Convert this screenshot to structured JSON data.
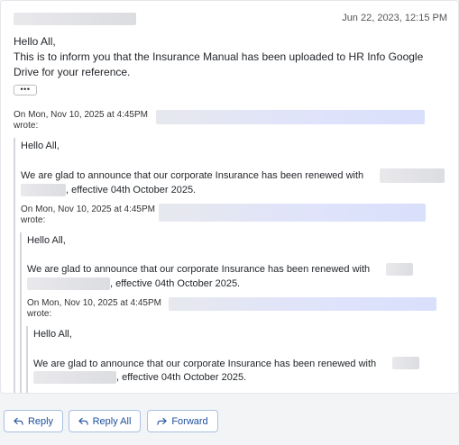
{
  "email": {
    "date": "Jun 22, 2023, 12:15 PM",
    "greeting": "Hello All,",
    "body": "This is to inform you that the Insurance Manual has been uploaded to HR Info Google Drive for your reference.",
    "show_trimmed_label": "•••"
  },
  "quotes": [
    {
      "attribution": "On Mon, Nov 10, 2025 at 4:45PM",
      "wrote": "wrote:",
      "greeting": "Hello All,",
      "text_before": "We are glad to announce that our corporate Insurance has been renewed with",
      "text_after": ", effective 04th October 2025."
    },
    {
      "attribution": "On Mon, Nov 10, 2025 at 4:45PM",
      "wrote": "wrote:",
      "greeting": "Hello All,",
      "text_before": "We are glad to announce that our corporate Insurance has been renewed with",
      "text_after": ", effective 04th October 2025."
    },
    {
      "attribution": "On Mon, Nov 10, 2025 at 4:45PM",
      "wrote": "wrote:",
      "greeting": "Hello All,",
      "text_before": "We are glad to announce that our corporate Insurance has been renewed with",
      "text_after": ", effective 04th October 2025."
    }
  ],
  "actions": {
    "reply": "Reply",
    "reply_all": "Reply All",
    "forward": "Forward",
    "reply_icon": "reply-icon",
    "reply_all_icon": "reply-all-icon",
    "forward_icon": "forward-icon"
  },
  "colors": {
    "accent": "#1e4f9c",
    "button_border": "#a9c0e3"
  }
}
